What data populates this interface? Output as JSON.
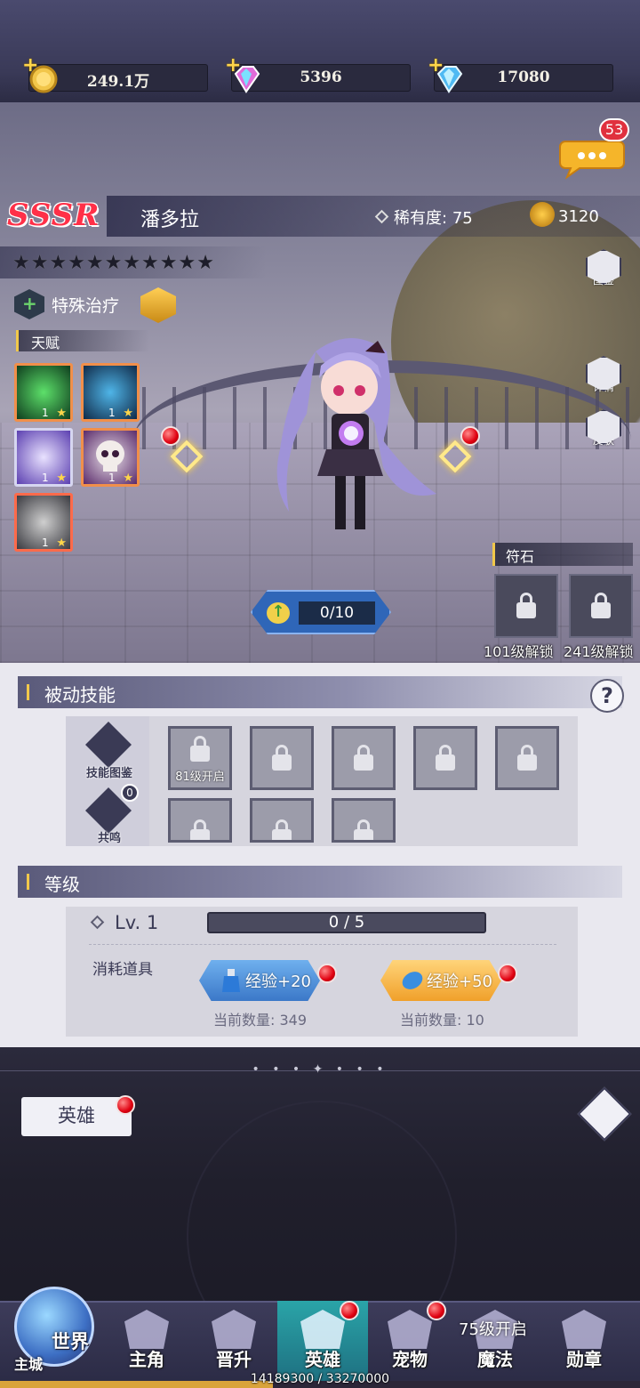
{
  "currency": {
    "gold": "249.1万",
    "gem_pink": "5396",
    "gem_blue": "17080"
  },
  "chat": {
    "badge": "53"
  },
  "hero": {
    "rank": "SSSR",
    "name": "潘多拉",
    "rarity_label": "稀有度:",
    "rarity_value": "75",
    "power": "3120",
    "stars": "★★★★★★★★★★★",
    "class_name": "特殊治疗",
    "talent_header": "天赋",
    "talents": [
      {
        "level": "1",
        "star": "★"
      },
      {
        "level": "1",
        "star": "★"
      },
      {
        "level": "1",
        "star": "★"
      },
      {
        "level": "1",
        "star": "★"
      },
      {
        "level": "1",
        "star": "★"
      }
    ],
    "star_progress": "0/10"
  },
  "side_buttons": {
    "codex": "图鉴",
    "details": "详情",
    "skin": "皮肤"
  },
  "runes": {
    "header": "符石",
    "slots": [
      {
        "label": "101级解锁"
      },
      {
        "label": "241级解锁"
      }
    ]
  },
  "passive": {
    "header": "被动技能",
    "help": "?",
    "codex_label": "技能图鉴",
    "resonance_label": "共鸣",
    "resonance_count": "0",
    "first_slot_caption": "81级开启"
  },
  "level": {
    "header": "等级",
    "lv": "Lv. 1",
    "exp": "0 / 5",
    "consume_label": "消耗道具",
    "items": [
      {
        "label": "经验+20",
        "qty": "当前数量: 349"
      },
      {
        "label": "经验+50",
        "qty": "当前数量: 10"
      }
    ]
  },
  "lower": {
    "tab": "英雄"
  },
  "nav": {
    "world": "世界",
    "main_city": "主城",
    "items": [
      "主角",
      "晋升",
      "英雄",
      "宠物",
      "魔法",
      "勋章"
    ],
    "magic_unlock": "75级开启",
    "exp_text": "14189300 / 33270000",
    "exp_fraction": 0.4265
  }
}
